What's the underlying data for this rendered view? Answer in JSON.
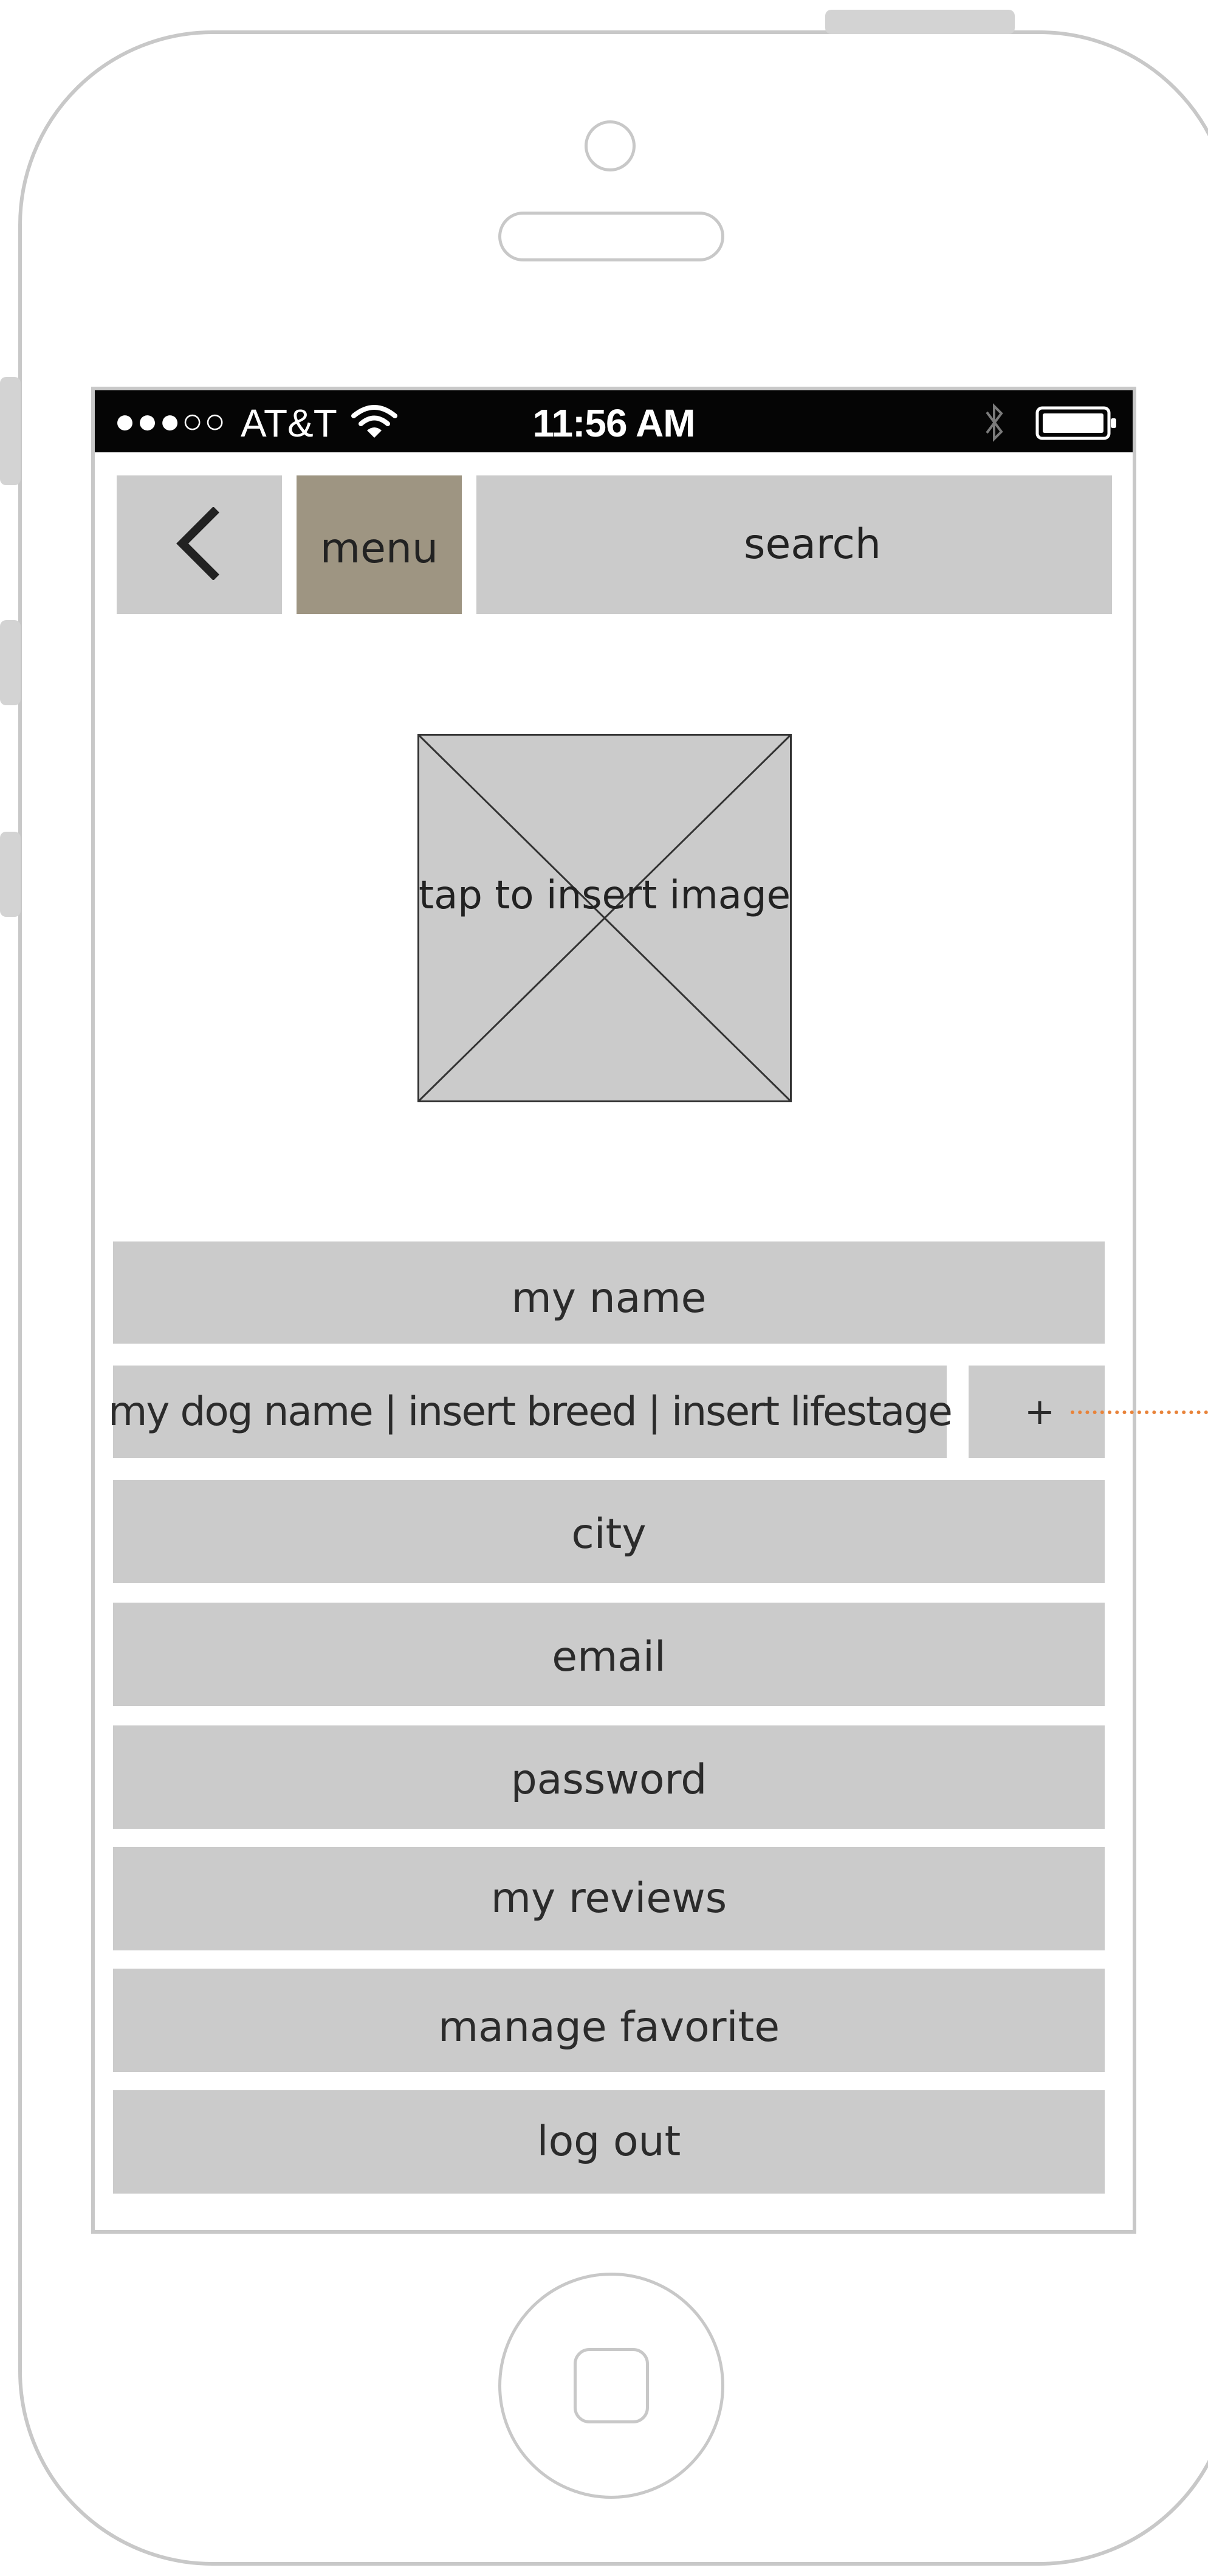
{
  "status_bar": {
    "signal": "●●●○○",
    "carrier": "AT&T",
    "time": "11:56 AM",
    "wifi_icon": "wifi-icon",
    "bluetooth_icon": "bluetooth-icon",
    "battery_icon": "battery-icon"
  },
  "nav": {
    "back_icon": "chevron-left-icon",
    "menu_label": "menu",
    "search_label": "search"
  },
  "profile_image": {
    "placeholder_text": "tap to insert image"
  },
  "fields": {
    "my_name": "my name",
    "dog_info": "my dog name | insert breed | insert lifestage",
    "add_dog": "+",
    "city": "city",
    "email": "email",
    "password": "password",
    "my_reviews": "my reviews",
    "manage_favorite": "manage favorite",
    "log_out": "log out"
  },
  "colors": {
    "field_bg": "#cbcbcb",
    "menu_bg": "#9e9582",
    "status_bar_bg": "#050505",
    "annotation_line": "#e8833a"
  }
}
